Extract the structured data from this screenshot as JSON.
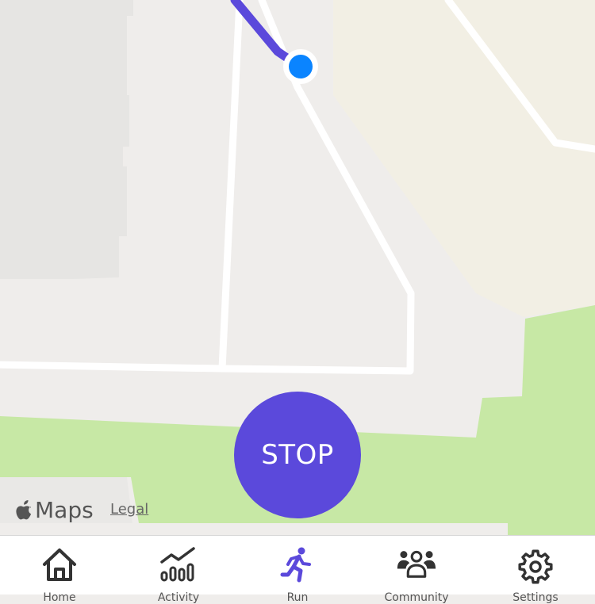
{
  "map": {
    "attribution": {
      "brand": "Maps",
      "legal_label": "Legal"
    },
    "colors": {
      "land": "#efedeb",
      "block": "#e6e5e3",
      "sand": "#f2efe4",
      "park": "#c7e8a5",
      "road": "#ffffff",
      "route": "#5b49db",
      "location_dot": "#0a84ff"
    }
  },
  "controls": {
    "stop_label": "STOP",
    "stop_color": "#5b49db"
  },
  "tabbar": {
    "active_color": "#5b49db",
    "inactive_color": "#333333",
    "active_index": 2,
    "tabs": [
      {
        "icon": "home-icon",
        "label": "Home"
      },
      {
        "icon": "stats-icon",
        "label": "Activity"
      },
      {
        "icon": "running-icon",
        "label": "Run"
      },
      {
        "icon": "group-icon",
        "label": "Community"
      },
      {
        "icon": "gear-icon",
        "label": "Settings"
      }
    ]
  }
}
